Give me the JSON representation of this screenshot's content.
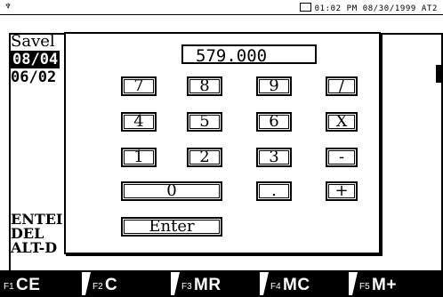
{
  "status": {
    "left_icon": "tree-icon",
    "datetime": "01:02 PM 08/30/1999 AT2"
  },
  "background": {
    "title": "Savel",
    "rows": [
      "08/04",
      "06/02"
    ],
    "hint_lines": [
      "ENTEI",
      "DEL",
      "ALT-D"
    ]
  },
  "calculator": {
    "display": "579.000",
    "keys": {
      "k7": "7",
      "k8": "8",
      "k9": "9",
      "kdiv": "/",
      "k4": "4",
      "k5": "5",
      "k6": "6",
      "kmul": "X",
      "k1": "1",
      "k2": "2",
      "k3": "3",
      "kminus": "-",
      "k0": "0",
      "kdot": ".",
      "kplus": "+",
      "enter": "Enter"
    }
  },
  "fkeys": [
    {
      "num": "F1",
      "label": "CE"
    },
    {
      "num": "F2",
      "label": "C"
    },
    {
      "num": "F3",
      "label": "MR"
    },
    {
      "num": "F4",
      "label": "MC"
    },
    {
      "num": "F5",
      "label": "M+"
    }
  ]
}
